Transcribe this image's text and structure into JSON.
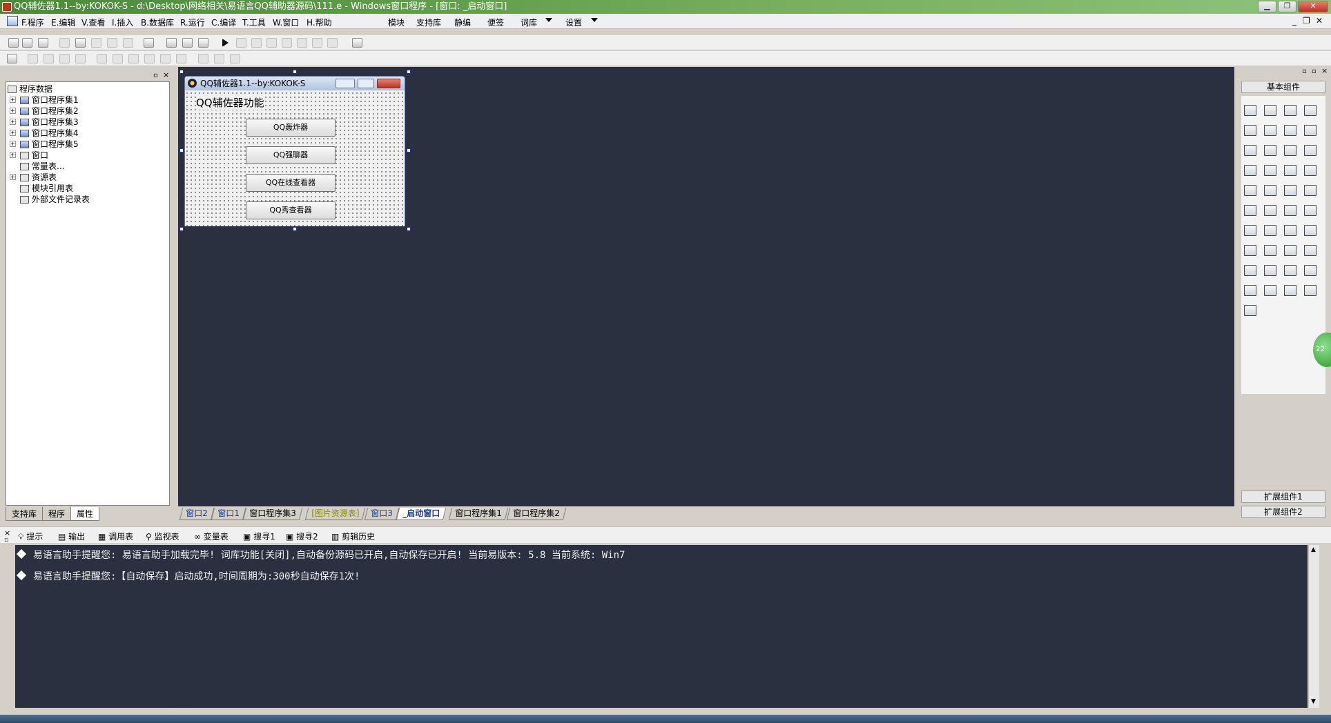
{
  "window": {
    "title": "QQ辅佐器1.1--by:KOKOK-S - d:\\Desktop\\网络相关\\易语言QQ辅助器源码\\111.e - Windows窗口程序 - [窗口: _启动窗口]",
    "min": "▁",
    "max": "❐",
    "close": "✕"
  },
  "menu": {
    "items": [
      "F.程序",
      "E.编辑",
      "V.查看",
      "I.插入",
      "B.数据库",
      "R.运行",
      "C.编译",
      "T.工具",
      "W.窗口",
      "H.帮助"
    ],
    "extras": [
      "模块",
      "支持库",
      "静编",
      "便签",
      "词库",
      "设置"
    ],
    "mdi_buttons": [
      "_",
      "❐",
      "✕"
    ]
  },
  "left_panel": {
    "tree": [
      {
        "label": "程序数据",
        "level": 0,
        "expand": ""
      },
      {
        "label": "窗口程序集1",
        "level": 1,
        "expand": "+"
      },
      {
        "label": "窗口程序集2",
        "level": 1,
        "expand": "+"
      },
      {
        "label": "窗口程序集3",
        "level": 1,
        "expand": "+"
      },
      {
        "label": "窗口程序集4",
        "level": 1,
        "expand": "+"
      },
      {
        "label": "窗口程序集5",
        "level": 1,
        "expand": "+"
      },
      {
        "label": "窗口",
        "level": 1,
        "expand": "+"
      },
      {
        "label": "常量表...",
        "level": 1,
        "expand": ""
      },
      {
        "label": "资源表",
        "level": 1,
        "expand": "+"
      },
      {
        "label": "模块引用表",
        "level": 1,
        "expand": ""
      },
      {
        "label": "外部文件记录表",
        "level": 1,
        "expand": ""
      }
    ],
    "tabs": [
      "支持库",
      "程序",
      "属性"
    ]
  },
  "design_window": {
    "title": "QQ辅佐器1.1--by:KOKOK-S",
    "label": "QQ辅佐器功能",
    "buttons": [
      "QQ轰炸器",
      "QQ强聊器",
      "QQ在线查看器",
      "QQ秀查看器"
    ]
  },
  "doc_tabs": [
    "窗口2",
    "窗口1",
    "窗口程序集3",
    "[图片资源表]",
    "窗口3",
    "_启动窗口",
    "窗口程序集1",
    "窗口程序集2"
  ],
  "right_panel": {
    "header": "基本组件",
    "footer": [
      "扩展组件1",
      "扩展组件2"
    ]
  },
  "output_tabs": [
    "提示",
    "输出",
    "调用表",
    "监视表",
    "变量表",
    "搜寻1",
    "搜寻2",
    "剪辑历史"
  ],
  "output_lines": [
    "易语言助手提醒您:  易语言助手加载完毕! 词库功能[关闭],自动备份源码已开启,自动保存已开启!  当前易版本: 5.8  当前系统: Win7",
    "易语言助手提醒您:【自动保存】启动成功,时间周期为:300秒自动保存1次!"
  ],
  "side_badge": "22"
}
